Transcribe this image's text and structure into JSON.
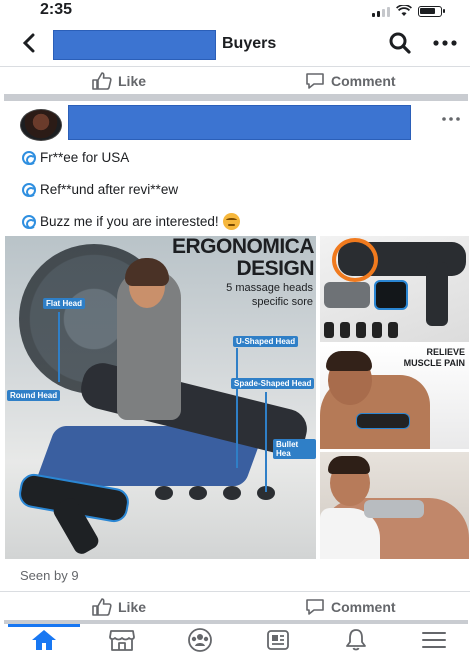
{
  "status_bar": {
    "time": "2:35"
  },
  "nav": {
    "title": "Buyers"
  },
  "actions": {
    "like_label": "Like",
    "comment_label": "Comment"
  },
  "post": {
    "lines": [
      "Fr**ee for USA",
      "Ref**und after revi**ew",
      "Buzz me if you are interested!"
    ],
    "image_text": {
      "title_line1": "ERGONOMICA",
      "title_line2": "DESIGN",
      "subtitle_line1": "5 massage heads",
      "subtitle_line2": "specific sore",
      "label_flat": "Flat Head",
      "label_ushaped": "U-Shaped Head",
      "label_spade": "Spade-Shaped Head",
      "label_round": "Round Head",
      "label_bullet": "Bullet Hea",
      "relieve_line1": "RELIEVE",
      "relieve_line2": "MUSCLE PAIN"
    },
    "seen_by": "Seen by 9"
  },
  "colors": {
    "accent": "#1877f2",
    "redaction": "#3c74d1",
    "text_muted": "#65676b"
  },
  "tabbar": {
    "icons": [
      "home-icon",
      "marketplace-icon",
      "groups-icon",
      "news-icon",
      "notifications-icon",
      "menu-icon"
    ],
    "active_index": 0
  }
}
